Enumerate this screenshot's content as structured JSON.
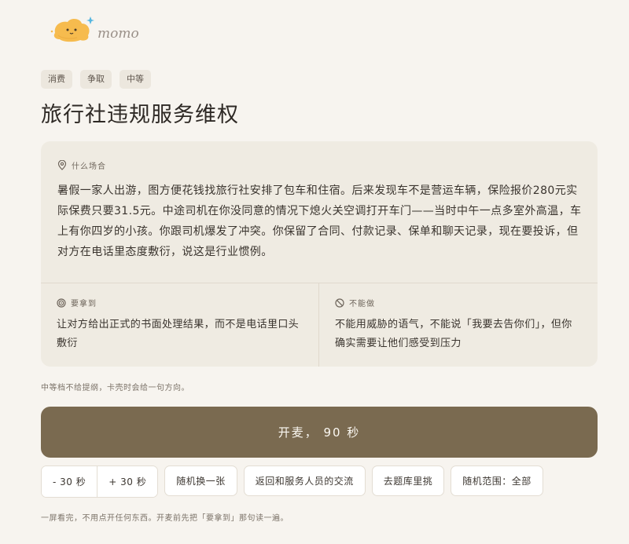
{
  "brand": {
    "logo_text": "momo",
    "accent_color": "#f6bb4e",
    "sparkle_color": "#55b6e0"
  },
  "tags": [
    "消费",
    "争取",
    "中等"
  ],
  "title": "旅行社违规服务维权",
  "scenario": {
    "label": "什么场合",
    "icon": "location-pin-icon",
    "text": "暑假一家人出游，图方便花钱找旅行社安排了包车和住宿。后来发现车不是营运车辆，保险报价280元实际保费只要31.5元。中途司机在你没同意的情况下熄火关空调打开车门——当时中午一点多室外高温，车上有你四岁的小孩。你跟司机爆发了冲突。你保留了合同、付款记录、保单和聊天记录，现在要投诉，但对方在电话里态度敷衍，说这是行业惯例。"
  },
  "goal": {
    "label": "要拿到",
    "icon": "target-icon",
    "text": "让对方给出正式的书面处理结果，而不是电话里口头敷衍"
  },
  "constraint": {
    "label": "不能做",
    "icon": "forbidden-icon",
    "text": "不能用威胁的语气，不能说「我要去告你们」，但你确实需要让他们感受到压力"
  },
  "hint": "中等档不给提纲，卡壳时会给一句方向。",
  "start_button": "开麦， 90 秒",
  "controls": {
    "minus_time": "- 30 秒",
    "plus_time": "+ 30 秒",
    "random_swap": "随机换一张",
    "back": "返回和服务人员的交流",
    "question_bank": "去题库里挑",
    "random_scope": "随机范围：全部"
  },
  "footer_note": "一屏看完，不用点开任何东西。开麦前先把「要拿到」那句读一遍。",
  "colors": {
    "background": "#f7f4ef",
    "panel": "#efebe2",
    "primary_button": "#7a6a50"
  }
}
